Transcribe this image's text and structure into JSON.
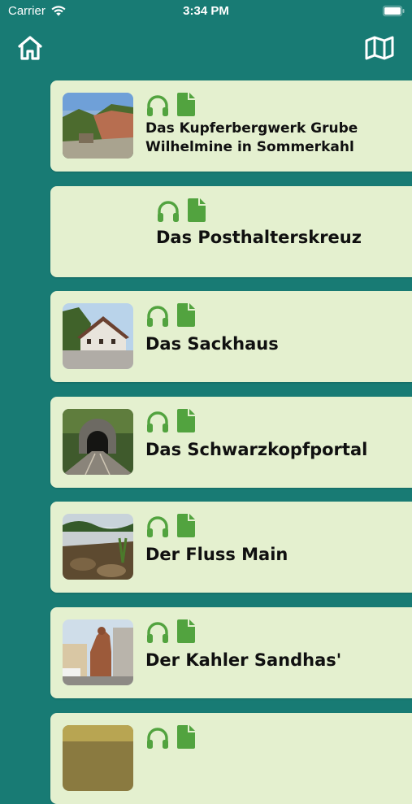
{
  "status_bar": {
    "carrier": "Carrier",
    "time": "3:34 PM"
  },
  "nav": {
    "home_icon": "home-icon",
    "map_icon": "map-icon"
  },
  "colors": {
    "background": "#187b74",
    "card": "#e4f0cf",
    "icon_green": "#52a33f"
  },
  "items": [
    {
      "title": "Das Kupferbergwerk Grube Wilhelmine in Sommerkahl",
      "has_image": true,
      "audio_icon": "headphones-icon",
      "doc_icon": "document-icon"
    },
    {
      "title": "Das Posthalterskreuz",
      "has_image": false,
      "audio_icon": "headphones-icon",
      "doc_icon": "document-icon"
    },
    {
      "title": "Das Sackhaus",
      "has_image": true,
      "audio_icon": "headphones-icon",
      "doc_icon": "document-icon"
    },
    {
      "title": "Das Schwarzkopfportal",
      "has_image": true,
      "audio_icon": "headphones-icon",
      "doc_icon": "document-icon"
    },
    {
      "title": "Der Fluss Main",
      "has_image": true,
      "audio_icon": "headphones-icon",
      "doc_icon": "document-icon"
    },
    {
      "title": "Der Kahler Sandhas'",
      "has_image": true,
      "audio_icon": "headphones-icon",
      "doc_icon": "document-icon"
    },
    {
      "title": "",
      "has_image": true,
      "audio_icon": "headphones-icon",
      "doc_icon": "document-icon"
    }
  ]
}
